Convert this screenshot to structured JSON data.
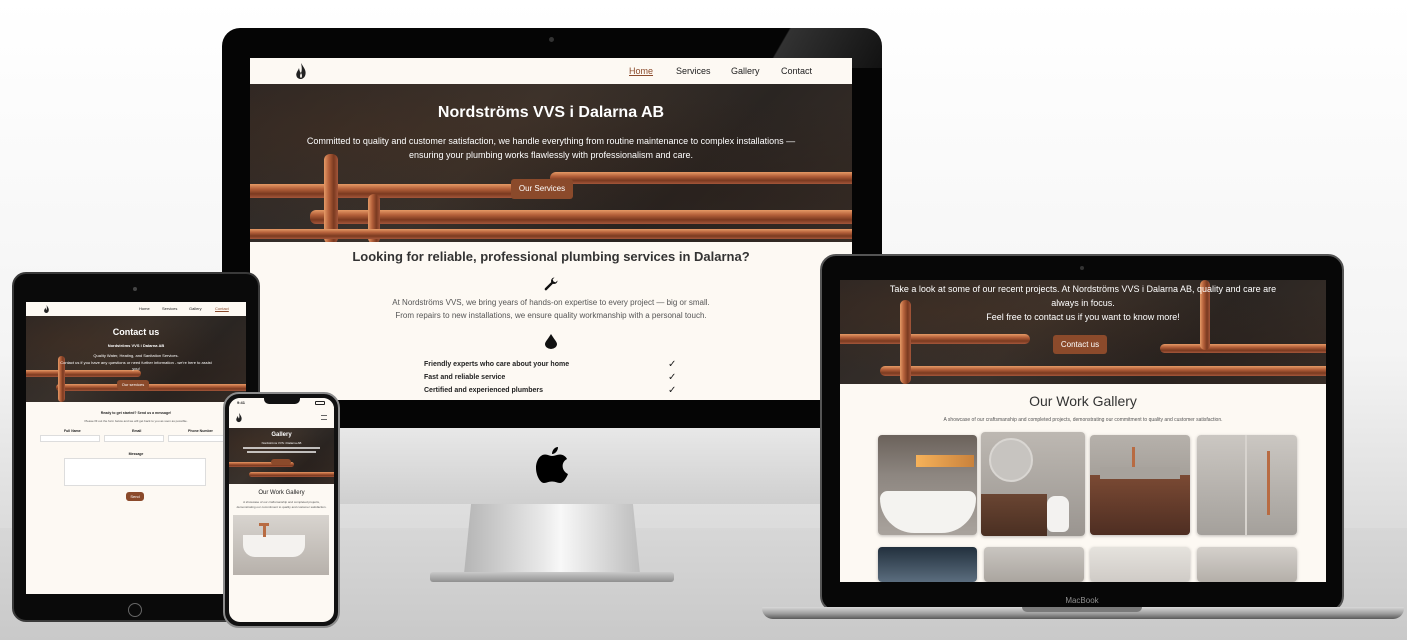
{
  "brand": {
    "accent": "#8b4a2b",
    "bg": "#fdf9f3",
    "logo_icon": "flame-icon"
  },
  "nav": {
    "home": "Home",
    "services": "Services",
    "gallery": "Gallery",
    "contact": "Contact"
  },
  "desktop": {
    "hero_title": "Nordströms VVS i Dalarna AB",
    "hero_text_1": "Committed to quality and customer satisfaction, we handle everything from routine maintenance to complex installations —",
    "hero_text_2": "ensuring your plumbing works flawlessly with professionalism and care.",
    "hero_button": "Our Services",
    "section_title": "Looking for reliable, professional plumbing services in Dalarna?",
    "section_icon_1": "wrench-icon",
    "intro_1": "At Nordströms VVS, we bring years of hands-on expertise to every project — big or small.",
    "intro_2": "From repairs to new installations, we ensure quality workmanship with a personal touch.",
    "section_icon_2": "water-drop-icon",
    "features": [
      "Friendly experts who care about your home",
      "Fast and reliable service",
      "Certified and experienced plumbers"
    ],
    "check": "✓"
  },
  "tablet": {
    "hero_title": "Contact us",
    "hero_sub": "Nordströms VVS i Dalarna AB",
    "hero_text_1": "Quality Water, Heating, and Sanitation Services.",
    "hero_text_2": "Contact us if you have any questions or need further information - we're here to assist",
    "hero_text_3": "you!",
    "hero_button": "Our services",
    "form_title": "Ready to get started? Send us a message!",
    "form_sub": "Please fill out the form below and we will get back to you as soon as possible.",
    "field_name": "Full Name",
    "field_email": "Email",
    "field_phone": "Phone Number",
    "field_message": "Message",
    "send_button": "Send"
  },
  "phone": {
    "time": "9:41",
    "hero_title": "Gallery",
    "hero_sub": "Nordströms VVS i Dalarna AB",
    "section_title": "Our Work Gallery",
    "section_text_1": "A showcase of our craftsmanship and completed projects,",
    "section_text_2": "demonstrating our commitment to quality and customer satisfaction."
  },
  "laptop": {
    "hero_text_1": "Take a look at some of our recent projects. At Nordströms VVS i Dalarna AB, quality and care are",
    "hero_text_2": "always in focus.",
    "hero_text_3": "Feel free to contact us if you want to know more!",
    "hero_button": "Contact us",
    "section_title": "Our Work Gallery",
    "section_text": "A showcase of our craftsmanship and completed projects, demonstrating our commitment to quality and customer satisfaction.",
    "brand_label": "MacBook"
  }
}
